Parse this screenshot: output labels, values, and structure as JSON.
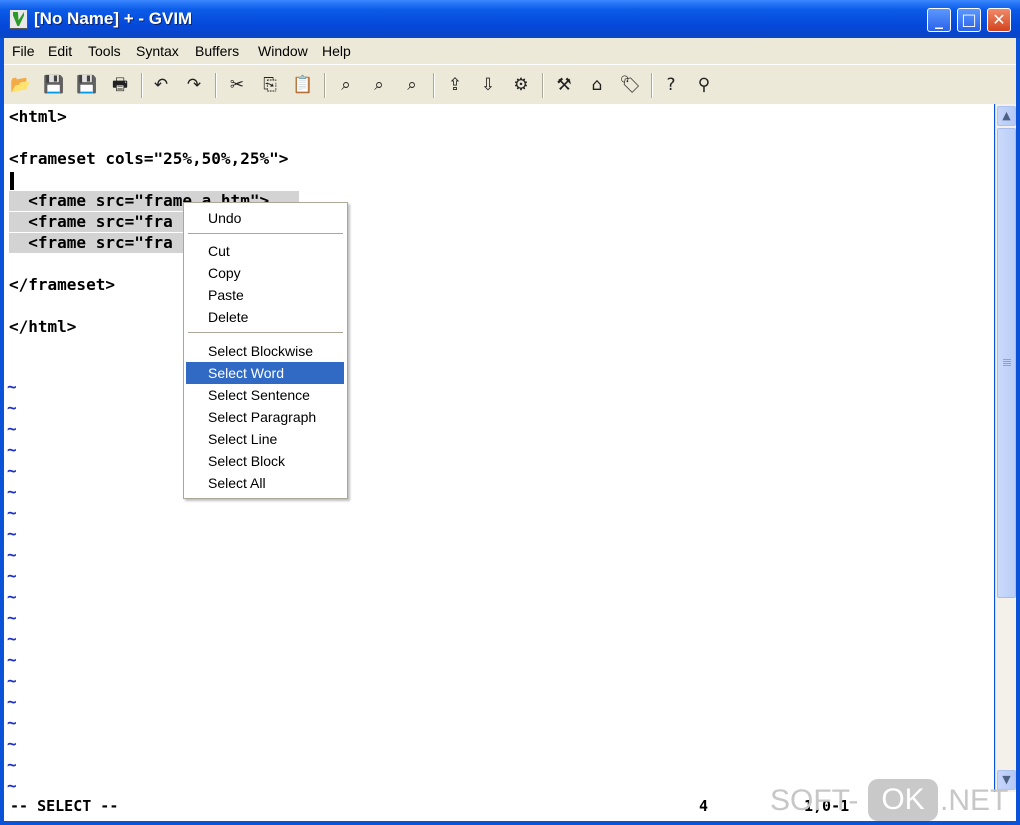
{
  "window": {
    "title": "[No Name] + - GVIM",
    "minimize_glyph": "_",
    "maximize_glyph": "□",
    "close_glyph": "✕"
  },
  "menubar": [
    "File",
    "Edit",
    "Tools",
    "Syntax",
    "Buffers",
    "Window",
    "Help"
  ],
  "toolbar": {
    "icons": [
      {
        "name": "open-icon",
        "glyph": "📂"
      },
      {
        "name": "save-icon",
        "glyph": "💾"
      },
      {
        "name": "save-all-icon",
        "glyph": "💾"
      },
      {
        "name": "print-icon",
        "glyph": "🖶"
      },
      {
        "name": "undo-icon",
        "glyph": "↶"
      },
      {
        "name": "redo-icon",
        "glyph": "↷"
      },
      {
        "name": "cut-icon",
        "glyph": "✂"
      },
      {
        "name": "copy-icon",
        "glyph": "⎘"
      },
      {
        "name": "paste-icon",
        "glyph": "📋"
      },
      {
        "name": "replace-icon",
        "glyph": "⌕"
      },
      {
        "name": "find-next-icon",
        "glyph": "⌕"
      },
      {
        "name": "find-prev-icon",
        "glyph": "⌕"
      },
      {
        "name": "load-session-icon",
        "glyph": "⇪"
      },
      {
        "name": "save-session-icon",
        "glyph": "⇩"
      },
      {
        "name": "run-script-icon",
        "glyph": "⚙"
      },
      {
        "name": "make-icon",
        "glyph": "⚒"
      },
      {
        "name": "shell-icon",
        "glyph": "⌂"
      },
      {
        "name": "tag-icon",
        "glyph": "🏷"
      },
      {
        "name": "help-icon",
        "glyph": "?"
      },
      {
        "name": "find-help-icon",
        "glyph": "⚲"
      }
    ]
  },
  "editor": {
    "lines": [
      "<html>",
      "",
      "<frameset cols=\"25%,50%,25%\">",
      "",
      "  <frame src=\"frame_a.htm\">",
      "  <frame src=\"fra",
      "  <frame src=\"fra",
      "",
      "</frameset>",
      "",
      "</html>"
    ],
    "empty_line_marker": "~"
  },
  "context_menu": {
    "groups": [
      [
        "Undo"
      ],
      [
        "Cut",
        "Copy",
        "Paste",
        "Delete"
      ],
      [
        "Select Blockwise",
        "Select Word",
        "Select Sentence",
        "Select Paragraph",
        "Select Line",
        "Select Block",
        "Select All"
      ]
    ],
    "highlighted": "Select Word"
  },
  "status": {
    "mode": "-- SELECT --",
    "ruler_left": "4",
    "ruler_right": "1,0-1"
  },
  "watermark": {
    "part1": "SOFT-",
    "part2": "OK",
    "part3": ".NET"
  },
  "colors": {
    "titlebar": "#0b5ce8",
    "menu_highlight": "#316ac5",
    "tilde": "#1a2ec8",
    "selection": "#d3d3d3"
  }
}
